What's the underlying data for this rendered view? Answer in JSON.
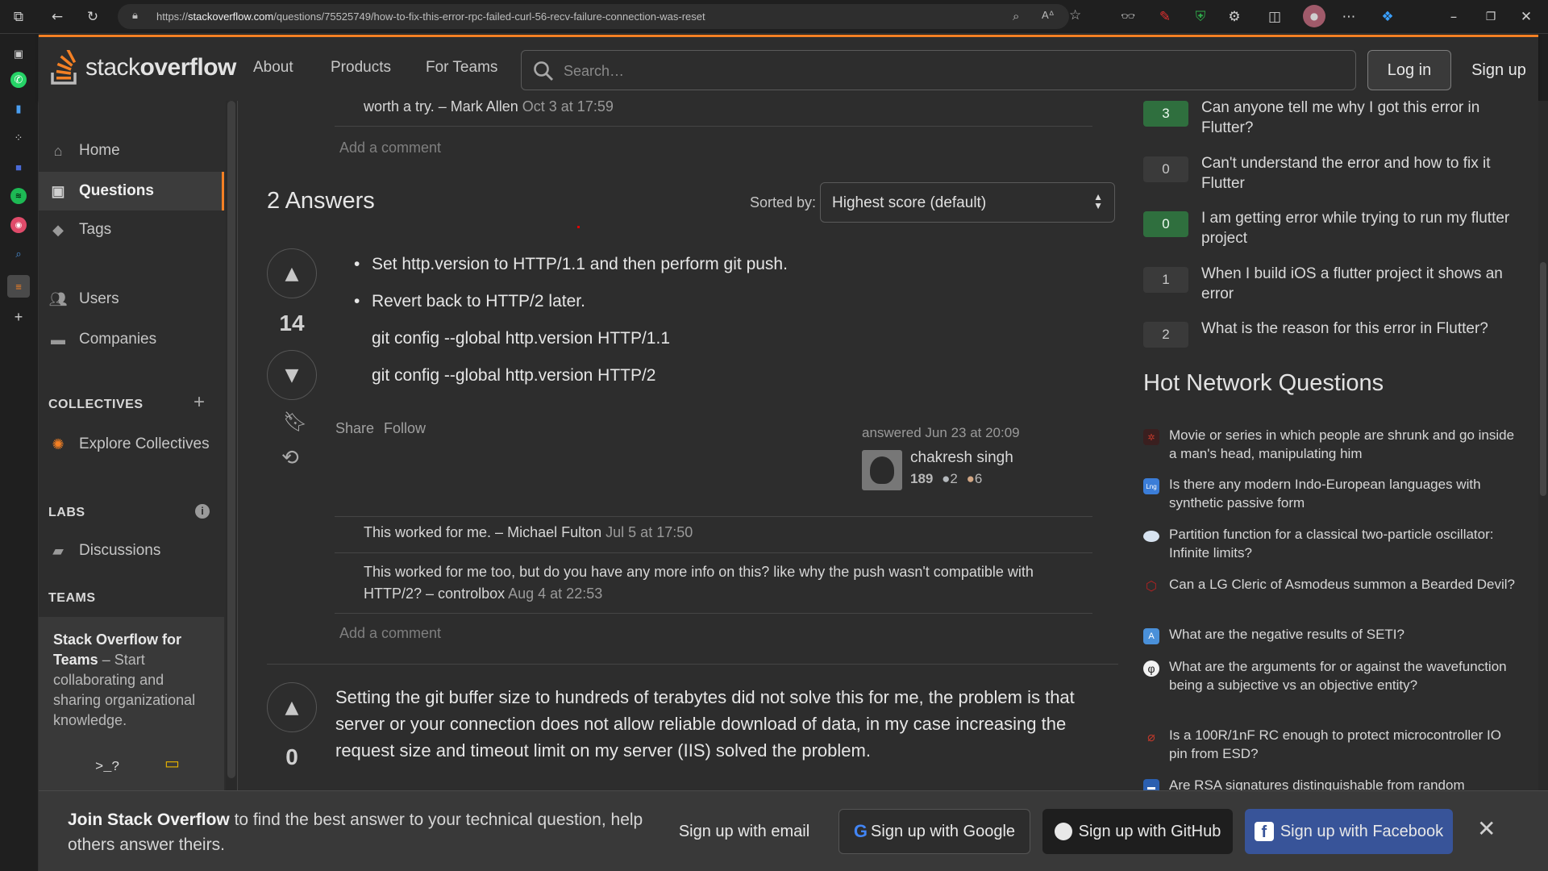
{
  "browser": {
    "url_prefix": "https://",
    "url_domain": "stackoverflow.com",
    "url_path": "/questions/75525749/how-to-fix-this-error-rpc-failed-curl-56-recv-failure-connection-was-reset"
  },
  "topbar": {
    "logo_word_light": "stack",
    "logo_word_bold": "overflow",
    "nav": [
      "About",
      "Products",
      "For Teams"
    ],
    "search_placeholder": "Search…",
    "login": "Log in",
    "signup": "Sign up"
  },
  "leftnav": {
    "home": "Home",
    "questions": "Questions",
    "tags": "Tags",
    "users": "Users",
    "companies": "Companies",
    "collectives_head": "COLLECTIVES",
    "explore_collectives": "Explore Collectives",
    "labs_head": "LABS",
    "discussions": "Discussions",
    "teams_head": "TEAMS",
    "teams_title": "Stack Overflow for Teams",
    "teams_desc": "– Start collaborating and sharing organizational knowledge.",
    "teams_prompt": ">_?"
  },
  "main": {
    "top_comment": {
      "text": "worth a try. –",
      "author": "Mark Allen",
      "date": "Oct 3 at 17:59"
    },
    "add_comment": "Add a comment",
    "answers_heading": "2 Answers",
    "sorted_by_label": "Sorted by:",
    "sort_value": "Highest score (default)",
    "answer1": {
      "score": "14",
      "bullets": [
        "Set http.version to HTTP/1.1 and then perform git push.",
        "Revert back to HTTP/2 later."
      ],
      "code_lines": [
        "git config --global http.version HTTP/1.1",
        "git config --global http.version HTTP/2"
      ],
      "share": "Share",
      "follow": "Follow",
      "answered": "answered Jun 23 at 20:09",
      "user": "chakresh singh",
      "rep": "189",
      "silver": "2",
      "bronze": "6",
      "comments": [
        {
          "text": "This worked for me. –",
          "author": "Michael Fulton",
          "date": "Jul 5 at 17:50"
        },
        {
          "text": "This worked for me too, but do you have any more info on this? like why the push wasn't compatible with HTTP/2? –",
          "author": "controlbox",
          "date": "Aug 4 at 22:53"
        }
      ]
    },
    "answer2": {
      "score": "0",
      "body": "Setting the git buffer size to hundreds of terabytes did not solve this for me, the problem is that server or your connection does not allow reliable download of data, in my case increasing the request size and timeout limit on my server (IIS) solved the problem."
    }
  },
  "related": [
    {
      "count": "3",
      "answered": true,
      "title": "Can anyone tell me why I got this error in Flutter?"
    },
    {
      "count": "0",
      "answered": false,
      "title": "Can't understand the error and how to fix it Flutter"
    },
    {
      "count": "0",
      "answered": true,
      "title": "I am getting error while trying to run my flutter project"
    },
    {
      "count": "1",
      "answered": false,
      "title": "When I build iOS a flutter project it shows an error"
    },
    {
      "count": "2",
      "answered": false,
      "title": "What is the reason for this error in Flutter?"
    }
  ],
  "hot_heading": "Hot Network Questions",
  "hot": [
    {
      "icon": "scifi-site-icon",
      "color": "#c0392b",
      "title": "Movie or series in which people are shrunk and go inside a man's head, manipulating him"
    },
    {
      "icon": "linguistics-site-icon",
      "color": "#3b7dd8",
      "title": "Is there any modern Indo-European languages with synthetic passive form"
    },
    {
      "icon": "physics-site-icon",
      "color": "#d7e3f0",
      "title": "Partition function for a classical two-particle oscillator: Infinite limits?"
    },
    {
      "icon": "rpg-site-icon",
      "color": "#b22222",
      "title": "Can a LG Cleric of Asmodeus summon a Bearded Devil?"
    },
    {
      "icon": "astronomy-site-icon",
      "color": "#4a90d9",
      "title": "What are the negative results of SETI?"
    },
    {
      "icon": "philosophy-site-icon",
      "color": "#f2f2f2",
      "title": "What are the arguments for or against the wavefunction being a subjective vs an objective entity?"
    },
    {
      "icon": "electronics-site-icon",
      "color": "#c0392b",
      "title": "Is a 100R/1nF RC enough to protect microcontroller IO pin from ESD?"
    },
    {
      "icon": "crypto-site-icon",
      "color": "#2b5fb0",
      "title": "Are RSA signatures distinguishable from random"
    }
  ],
  "banner": {
    "bold": "Join Stack Overflow",
    "rest": "to find the best answer to your technical question, help others answer theirs.",
    "email": "Sign up with email",
    "google": "Sign up with Google",
    "github": "Sign up with GitHub",
    "facebook": "Sign up with Facebook"
  },
  "colors": {
    "accent": "#f48024",
    "answered_green": "#2f6f3e",
    "facebook_blue": "#385499"
  }
}
